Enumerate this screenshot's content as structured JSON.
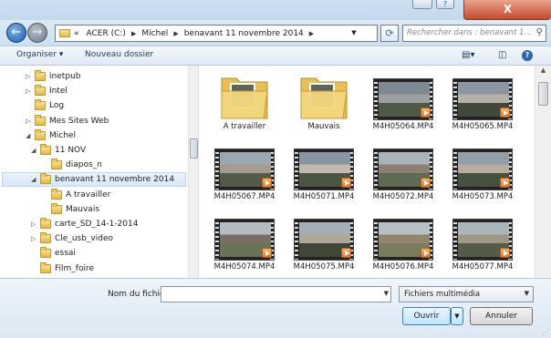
{
  "titlebar": {
    "close_label": "X",
    "help_label": "?"
  },
  "nav": {
    "breadcrumb_prefix": "«",
    "breadcrumb": [
      "ACER (C:)",
      "Michel",
      "benavant 11 novembre 2014"
    ],
    "search_placeholder": "Rechercher dans : benavant 1..."
  },
  "commandbar": {
    "organize": "Organiser ▾",
    "new_folder": "Nouveau dossier"
  },
  "tree": [
    {
      "label": "inetpub",
      "level": 1,
      "expand": "▷"
    },
    {
      "label": "Intel",
      "level": 1,
      "expand": "▷"
    },
    {
      "label": "Log",
      "level": 1,
      "expand": ""
    },
    {
      "label": "Mes Sites Web",
      "level": 1,
      "expand": "▷"
    },
    {
      "label": "Michel",
      "level": 1,
      "expand": "◢"
    },
    {
      "label": "11 NOV",
      "level": 2,
      "expand": "◢"
    },
    {
      "label": "diapos_n",
      "level": 3,
      "expand": ""
    },
    {
      "label": "benavant 11 novembre 2014",
      "level": 2,
      "expand": "◢",
      "selected": true
    },
    {
      "label": "A travailler",
      "level": 3,
      "expand": ""
    },
    {
      "label": "Mauvais",
      "level": 3,
      "expand": ""
    },
    {
      "label": "carte_SD_14-1-2014",
      "level": 2,
      "expand": "▷"
    },
    {
      "label": "Cle_usb_video",
      "level": 2,
      "expand": "▷"
    },
    {
      "label": "essai",
      "level": 2,
      "expand": ""
    },
    {
      "label": "Film_foire",
      "level": 2,
      "expand": ""
    }
  ],
  "files": [
    {
      "name": "A travailler",
      "kind": "folder"
    },
    {
      "name": "Mauvais",
      "kind": "folder"
    },
    {
      "name": "M4H05064.MP4",
      "kind": "video"
    },
    {
      "name": "M4H05065.MP4",
      "kind": "video"
    },
    {
      "name": "M4H05067.MP4",
      "kind": "video"
    },
    {
      "name": "M4H05071.MP4",
      "kind": "video"
    },
    {
      "name": "M4H05072.MP4",
      "kind": "video"
    },
    {
      "name": "M4H05073.MP4",
      "kind": "video"
    },
    {
      "name": "M4H05074.MP4",
      "kind": "video"
    },
    {
      "name": "M4H05075.MP4",
      "kind": "video"
    },
    {
      "name": "M4H05076.MP4",
      "kind": "video"
    },
    {
      "name": "M4H05077.MP4",
      "kind": "video"
    }
  ],
  "bottom": {
    "filename_label": "Nom du fichier :",
    "filename_value": "",
    "filetype": "Fichiers multimédia",
    "open": "Ouvrir",
    "cancel": "Annuler"
  },
  "colors": {
    "accent": "#3c7fb1",
    "selection": "#d6e8fa",
    "folder": "#e2b846"
  }
}
